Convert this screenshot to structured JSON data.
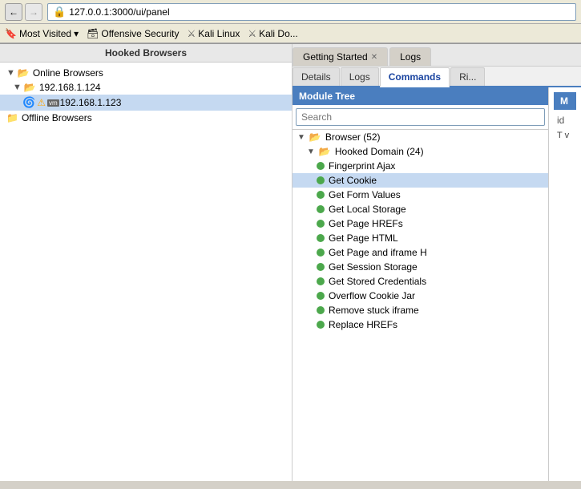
{
  "browser": {
    "address": "127.0.0.1:3000/ui/panel",
    "address_icon": "🔒",
    "back_label": "←",
    "forward_label": "→"
  },
  "bookmarks": [
    {
      "label": "Most Visited",
      "icon": "🔖",
      "has_arrow": true
    },
    {
      "label": "Offensive Security",
      "icon": "🗃"
    },
    {
      "label": "Kali Linux",
      "icon": "🐉"
    },
    {
      "label": "Kali Do...",
      "icon": "🐉"
    }
  ],
  "left_panel": {
    "header": "Hooked Browsers",
    "tree": [
      {
        "label": "Online Browsers",
        "indent": 0,
        "type": "folder-open",
        "arrow": "▼"
      },
      {
        "label": "192.168.1.124",
        "indent": 1,
        "type": "folder-open",
        "arrow": "▼"
      },
      {
        "label": "192.168.1.123",
        "indent": 2,
        "type": "browser",
        "icons": [
          "🌀",
          "⚠",
          "vm"
        ]
      },
      {
        "label": "Offline Browsers",
        "indent": 0,
        "type": "folder-closed",
        "arrow": ""
      }
    ]
  },
  "right_panel": {
    "tabs_row1": [
      {
        "label": "Getting Started",
        "closeable": true,
        "active": false
      },
      {
        "label": "Logs",
        "closeable": false,
        "active": false
      }
    ],
    "tabs_row2": [
      {
        "label": "Details",
        "active": false
      },
      {
        "label": "Logs",
        "active": false
      },
      {
        "label": "Commands",
        "active": true
      },
      {
        "label": "Ri...",
        "active": false
      }
    ],
    "module_tree": {
      "header": "Module Tree",
      "search_placeholder": "Search",
      "items": [
        {
          "label": "Browser (52)",
          "indent": 0,
          "arrow": "▼",
          "dot": false,
          "type": "folder"
        },
        {
          "label": "Hooked Domain (24)",
          "indent": 1,
          "arrow": "▼",
          "dot": false,
          "type": "folder"
        },
        {
          "label": "Fingerprint Ajax",
          "indent": 2,
          "arrow": "",
          "dot": true,
          "selected": false
        },
        {
          "label": "Get Cookie",
          "indent": 2,
          "arrow": "",
          "dot": true,
          "selected": true
        },
        {
          "label": "Get Form Values",
          "indent": 2,
          "arrow": "",
          "dot": true,
          "selected": false
        },
        {
          "label": "Get Local Storage",
          "indent": 2,
          "arrow": "",
          "dot": true,
          "selected": false
        },
        {
          "label": "Get Page HREFs",
          "indent": 2,
          "arrow": "",
          "dot": true,
          "selected": false
        },
        {
          "label": "Get Page HTML",
          "indent": 2,
          "arrow": "",
          "dot": true,
          "selected": false
        },
        {
          "label": "Get Page and iframe H",
          "indent": 2,
          "arrow": "",
          "dot": true,
          "selected": false
        },
        {
          "label": "Get Session Storage",
          "indent": 2,
          "arrow": "",
          "dot": true,
          "selected": false
        },
        {
          "label": "Get Stored Credentials",
          "indent": 2,
          "arrow": "",
          "dot": true,
          "selected": false
        },
        {
          "label": "Overflow Cookie Jar",
          "indent": 2,
          "arrow": "",
          "dot": true,
          "selected": false
        },
        {
          "label": "Remove stuck iframe",
          "indent": 2,
          "arrow": "",
          "dot": true,
          "selected": false
        },
        {
          "label": "Replace HREFs",
          "indent": 2,
          "arrow": "",
          "dot": true,
          "selected": false
        }
      ]
    },
    "info_panel": {
      "header": "M",
      "id_label": "id",
      "description": "T\nv"
    }
  }
}
